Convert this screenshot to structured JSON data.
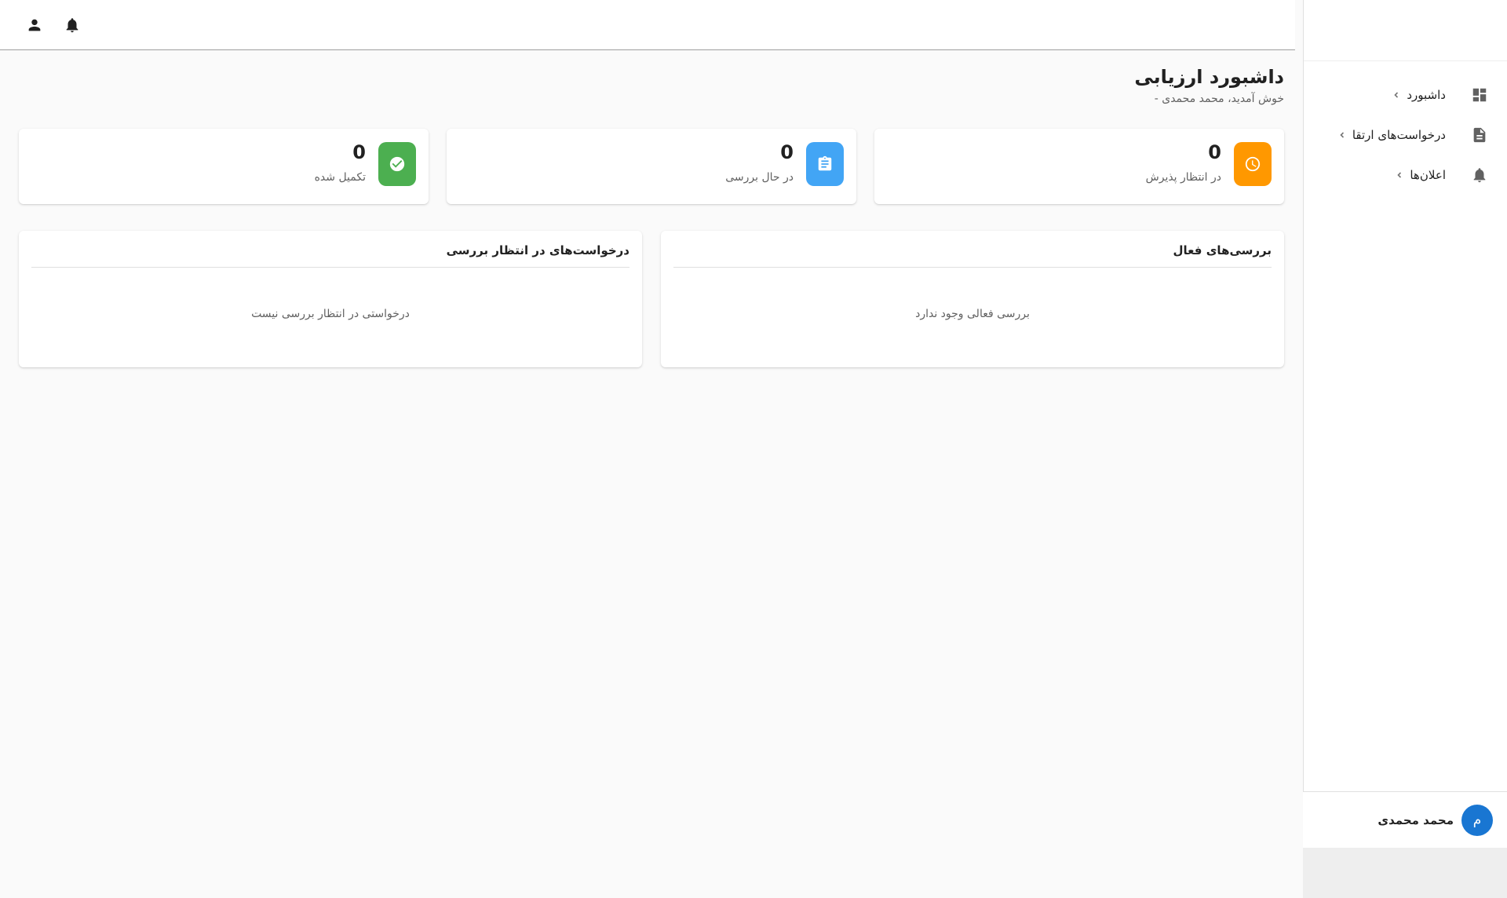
{
  "topbar": {
    "profile_icon": "person-icon",
    "notifications_icon": "bell-icon"
  },
  "sidebar": {
    "items": [
      {
        "label": "داشبورد",
        "icon": "dashboard-icon"
      },
      {
        "label": "درخواست‌های ارتقا",
        "icon": "document-icon"
      },
      {
        "label": "اعلان‌ها",
        "icon": "bell-icon"
      }
    ],
    "user": {
      "avatar_initial": "م",
      "name": "محمد محمدی"
    }
  },
  "header": {
    "title": "داشبورد ارزیابی",
    "subtitle": "خوش آمدید، محمد محمدی -"
  },
  "stats": [
    {
      "value": "0",
      "label": "در انتظار پذیرش",
      "color": "#ff9800",
      "icon": "clock-icon"
    },
    {
      "value": "0",
      "label": "در حال بررسی",
      "color": "#42a5f5",
      "icon": "clipboard-icon"
    },
    {
      "value": "0",
      "label": "تکمیل شده",
      "color": "#4caf50",
      "icon": "check-circle-icon"
    }
  ],
  "panels": {
    "active_reviews": {
      "title": "بررسی‌های فعال",
      "empty_text": "بررسی فعالی وجود ندارد"
    },
    "pending_requests": {
      "title": "درخواست‌های در انتظار بررسی",
      "empty_text": "درخواستی در انتظار بررسی نیست"
    }
  }
}
